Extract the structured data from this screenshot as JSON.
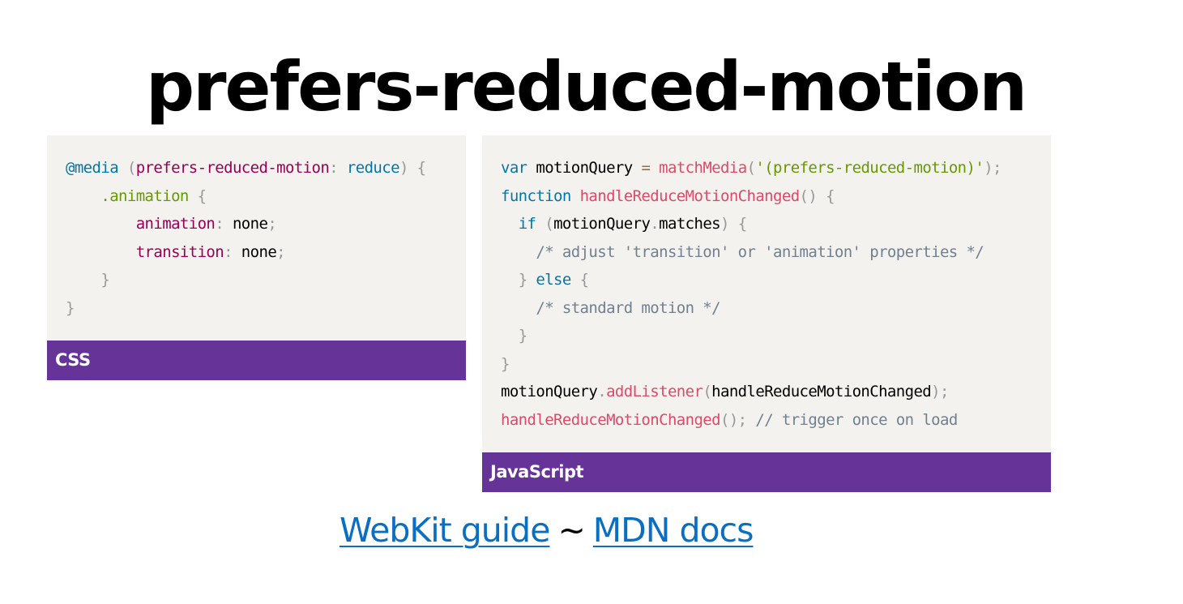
{
  "title": "prefers-reduced-motion",
  "css_panel": {
    "label": "CSS",
    "lines": {
      "l1": {
        "at": "@media",
        "open": "(",
        "prop": "prefers-reduced-motion",
        "colon": ":",
        "val": "reduce",
        "close": ")",
        "brace": "{"
      },
      "l2": {
        "sel": ".animation",
        "brace": "{"
      },
      "l3": {
        "prop": "animation",
        "colon": ":",
        "val": "none",
        "semi": ";"
      },
      "l4": {
        "prop": "transition",
        "colon": ":",
        "val": "none",
        "semi": ";"
      },
      "l5": {
        "brace": "}"
      },
      "l6": {
        "brace": "}"
      }
    }
  },
  "js_panel": {
    "label": "JavaScript",
    "lines": {
      "l1": {
        "kw": "var",
        "id": "motionQuery",
        "op": "=",
        "fn": "matchMedia",
        "open": "(",
        "str": "'(prefers-reduced-motion)'",
        "close": ");"
      },
      "l2": {
        "kw": "function",
        "fn": "handleReduceMotionChanged",
        "parens": "()",
        "brace": "{"
      },
      "l3": {
        "kw": "if",
        "open": "(",
        "obj": "motionQuery",
        "dot": ".",
        "prop": "matches",
        "close": ")",
        "brace": "{"
      },
      "l4": {
        "cmt": "/* adjust 'transition' or 'animation' properties */"
      },
      "l5": {
        "close": "}",
        "kw": "else",
        "brace": "{"
      },
      "l6": {
        "cmt": "/* standard motion */"
      },
      "l7": {
        "brace": "}"
      },
      "l8": {
        "brace": "}"
      },
      "l9": {
        "obj": "motionQuery",
        "dot": ".",
        "fn": "addListener",
        "open": "(",
        "arg": "handleReduceMotionChanged",
        "close": ");"
      },
      "l10": {
        "fn": "handleReduceMotionChanged",
        "punc": "();",
        "cmt": "// trigger once on load"
      }
    }
  },
  "links": {
    "webkit": "WebKit guide",
    "separator": "~",
    "mdn": "MDN docs"
  },
  "colors": {
    "accent": "#663399",
    "link": "#0a6fc2",
    "code_bg": "#f4f2ef"
  }
}
